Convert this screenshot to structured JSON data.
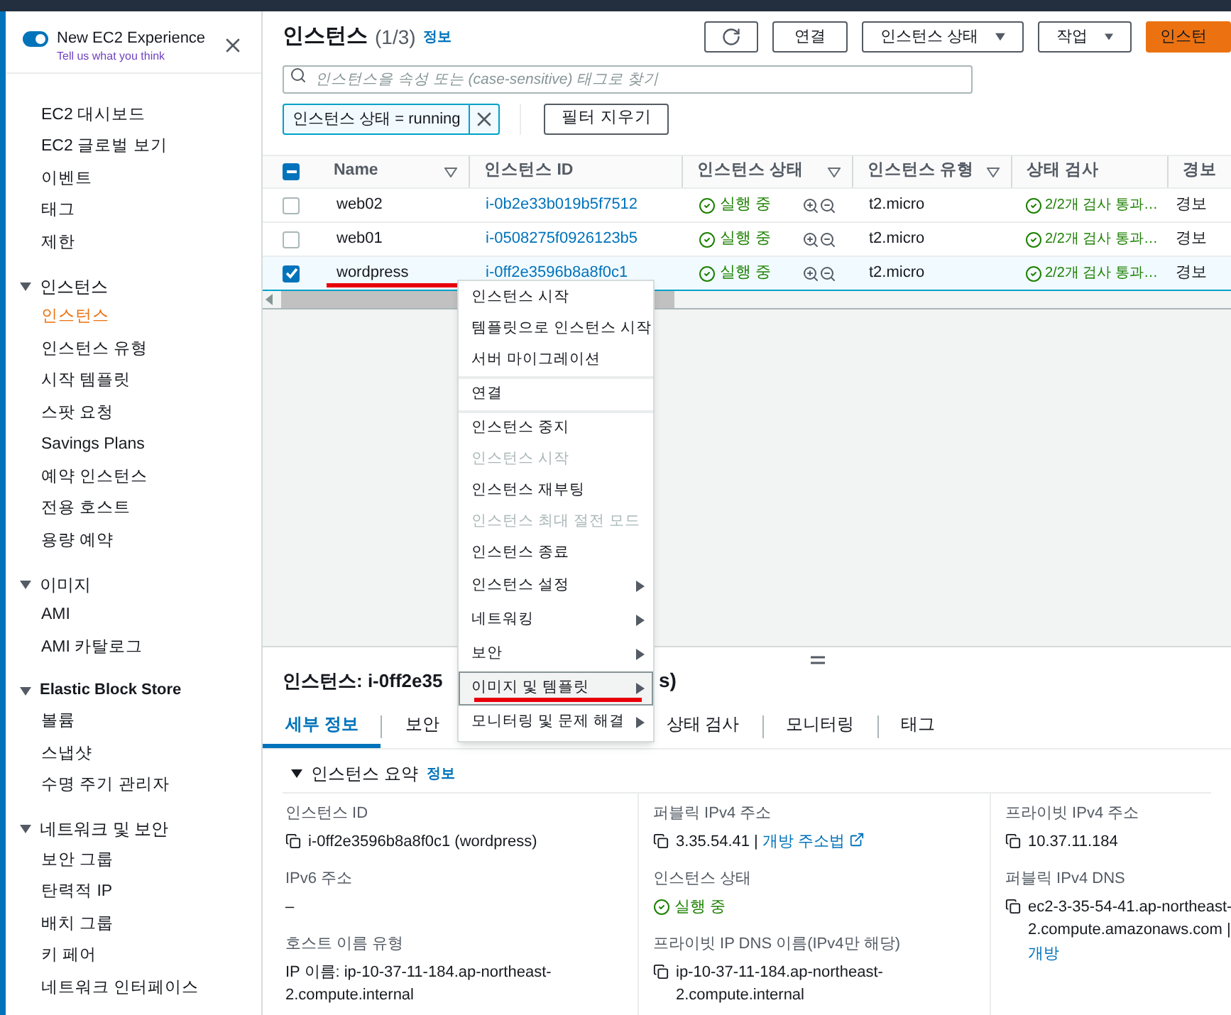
{
  "sidebar": {
    "experience": {
      "on": true,
      "title": "New EC2 Experience",
      "feedback_link": "Tell us what you think"
    },
    "sections": [
      {
        "items": [
          {
            "label": "EC2 대시보드",
            "selected": false
          },
          {
            "label": "EC2 글로벌 보기",
            "selected": false
          },
          {
            "label": "이벤트",
            "selected": false
          },
          {
            "label": "태그",
            "selected": false
          },
          {
            "label": "제한",
            "selected": false
          }
        ]
      },
      {
        "heading": "인스턴스",
        "expanded": true,
        "items": [
          {
            "label": "인스턴스",
            "selected": true
          },
          {
            "label": "인스턴스 유형",
            "selected": false
          },
          {
            "label": "시작 템플릿",
            "selected": false
          },
          {
            "label": "스팟 요청",
            "selected": false
          },
          {
            "label": "Savings Plans",
            "selected": false
          },
          {
            "label": "예약 인스턴스",
            "selected": false
          },
          {
            "label": "전용 호스트",
            "selected": false
          },
          {
            "label": "용량 예약",
            "selected": false
          }
        ]
      },
      {
        "heading": "이미지",
        "expanded": true,
        "items": [
          {
            "label": "AMI",
            "selected": false
          },
          {
            "label": "AMI 카탈로그",
            "selected": false
          }
        ]
      },
      {
        "heading": "Elastic Block Store",
        "expanded": true,
        "items": [
          {
            "label": "볼륨",
            "selected": false
          },
          {
            "label": "스냅샷",
            "selected": false
          },
          {
            "label": "수명 주기 관리자",
            "selected": false
          }
        ]
      },
      {
        "heading": "네트워크 및 보안",
        "expanded": true,
        "items": [
          {
            "label": "보안 그룹",
            "selected": false
          },
          {
            "label": "탄력적 IP",
            "selected": false
          },
          {
            "label": "배치 그룹",
            "selected": false
          },
          {
            "label": "키 페어",
            "selected": false
          },
          {
            "label": "네트워크 인터페이스",
            "selected": false
          }
        ]
      }
    ]
  },
  "header": {
    "title": "인스턴스",
    "count": "(1/3)",
    "info": "정보",
    "buttons": [
      {
        "kind": "refresh"
      },
      {
        "kind": "plain",
        "label": "연결"
      },
      {
        "kind": "dropdown",
        "label": "인스턴스 상태"
      },
      {
        "kind": "dropdown",
        "label": "작업"
      },
      {
        "kind": "primary",
        "label": "인스턴"
      }
    ]
  },
  "search": {
    "placeholder": "인스턴스을 속성 또는 (case-sensitive) 태그로 찾기"
  },
  "filter": {
    "chip": "인스턴스 상태 = running",
    "clear_button": "필터 지우기"
  },
  "table": {
    "select_all_partial": true,
    "columns": [
      {
        "label": "Name",
        "filter": true
      },
      {
        "label": "인스턴스 ID",
        "filter": false
      },
      {
        "label": "인스턴스 상태",
        "filter": true
      },
      {
        "label": "인스턴스 유형",
        "filter": true
      },
      {
        "label": "상태 검사",
        "filter": false
      },
      {
        "label": "경보",
        "filter": false
      }
    ],
    "rows": [
      {
        "name": "web02",
        "id": "i-0b2e33b019b5f7512",
        "state": "실행 중",
        "type": "t2.micro",
        "checks": "2/2개 검사 통과…",
        "alarm": "경보",
        "selected": false,
        "marked": false
      },
      {
        "name": "web01",
        "id": "i-0508275f0926123b5",
        "state": "실행 중",
        "type": "t2.micro",
        "checks": "2/2개 검사 통과…",
        "alarm": "경보",
        "selected": false,
        "marked": false
      },
      {
        "name": "wordpress",
        "id": "i-0ff2e3596b8a8f0c1",
        "state": "실행 중",
        "type": "t2.micro",
        "checks": "2/2개 검사 통과…",
        "alarm": "경보",
        "selected": true,
        "marked": true
      }
    ]
  },
  "context_menu": {
    "groups": [
      [
        {
          "label": "인스턴스 시작",
          "kind": "item",
          "disabled": false,
          "highlighted": false,
          "marked": false
        },
        {
          "label": "템플릿으로 인스턴스 시작",
          "kind": "item",
          "disabled": false,
          "highlighted": false,
          "marked": false
        },
        {
          "label": "서버 마이그레이션",
          "kind": "item",
          "disabled": false,
          "highlighted": false,
          "marked": false
        }
      ],
      [
        {
          "label": "연결",
          "kind": "item",
          "disabled": false,
          "highlighted": false,
          "marked": false
        }
      ],
      [
        {
          "label": "인스턴스 중지",
          "kind": "item",
          "disabled": false,
          "highlighted": false,
          "marked": false
        },
        {
          "label": "인스턴스 시작",
          "kind": "item",
          "disabled": true,
          "highlighted": false,
          "marked": false
        },
        {
          "label": "인스턴스 재부팅",
          "kind": "item",
          "disabled": false,
          "highlighted": false,
          "marked": false
        },
        {
          "label": "인스턴스 최대 절전 모드",
          "kind": "item",
          "disabled": true,
          "highlighted": false,
          "marked": false
        },
        {
          "label": "인스턴스 종료",
          "kind": "item",
          "disabled": false,
          "highlighted": false,
          "marked": false
        },
        {
          "label": "인스턴스 설정",
          "kind": "submenu",
          "disabled": false,
          "highlighted": false,
          "marked": false
        },
        {
          "label": "네트워킹",
          "kind": "submenu",
          "disabled": false,
          "highlighted": false,
          "marked": false
        },
        {
          "label": "보안",
          "kind": "submenu",
          "disabled": false,
          "highlighted": false,
          "marked": false
        },
        {
          "label": "이미지 및 템플릿",
          "kind": "submenu",
          "disabled": false,
          "highlighted": true,
          "marked": true
        },
        {
          "label": "모니터링 및 문제 해결",
          "kind": "submenu",
          "disabled": false,
          "highlighted": false,
          "marked": false
        }
      ]
    ]
  },
  "detail": {
    "title": "인스턴스: i-0ff2e35",
    "title_tail": "s)",
    "tabs": [
      {
        "label": "세부 정보",
        "selected": true
      },
      {
        "label": "보안",
        "selected": false
      },
      {
        "label": "상태 검사",
        "selected": false
      },
      {
        "label": "모니터링",
        "selected": false
      },
      {
        "label": "태그",
        "selected": false
      }
    ],
    "summary": {
      "heading": "인스턴스 요약",
      "info": "정보",
      "expanded": true,
      "columns": [
        [
          {
            "label": "인스턴스 ID",
            "kind": "copy",
            "value": "i-0ff2e3596b8a8f0c1 (wordpress)"
          },
          {
            "label": "IPv6 주소",
            "kind": "plain",
            "value": "–"
          },
          {
            "label": "호스트 이름 유형",
            "kind": "plain",
            "value": "IP 이름: ip-10-37-11-184.ap-northeast-2.compute.internal"
          }
        ],
        [
          {
            "label": "퍼블릭 IPv4 주소",
            "kind": "copy",
            "value": "3.35.54.41",
            "separator": "|",
            "link": "개방 주소법",
            "external": true
          },
          {
            "label": "인스턴스 상태",
            "kind": "status",
            "value": "실행 중"
          },
          {
            "label": "프라이빗 IP DNS 이름(IPv4만 해당)",
            "kind": "copy",
            "value": "ip-10-37-11-184.ap-northeast-2.compute.internal"
          }
        ],
        [
          {
            "label": "프라이빗 IPv4 주소",
            "kind": "copy",
            "value": "10.37.11.184"
          },
          {
            "label": "퍼블릭 IPv4 DNS",
            "kind": "copy",
            "value": "ec2-3-35-54-41.ap-northeast-2.compute.amazonaws.com",
            "separator": "|",
            "link": "개방",
            "external": false
          }
        ]
      ]
    }
  }
}
